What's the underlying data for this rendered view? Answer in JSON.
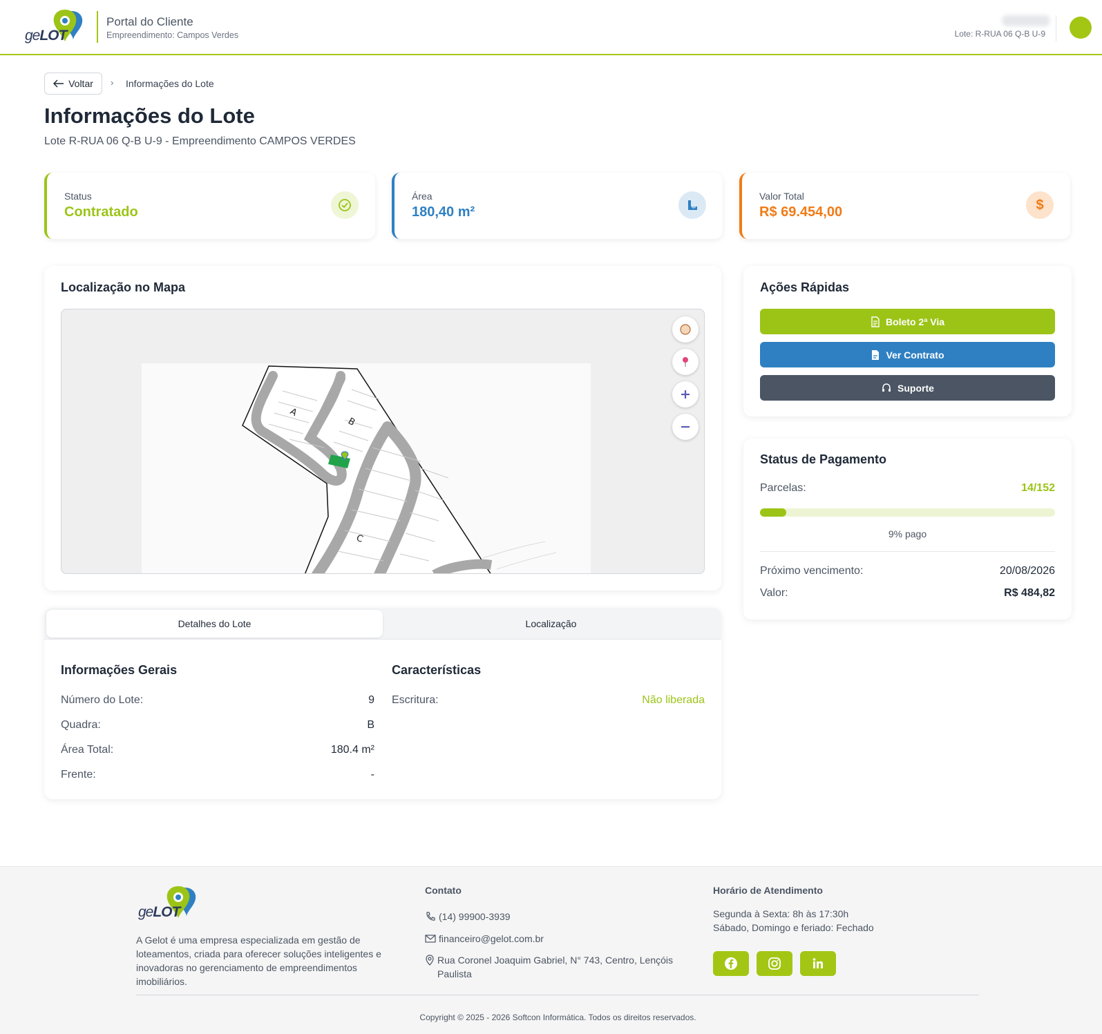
{
  "header": {
    "logo_ge": "ge",
    "logo_lot": "LOT",
    "portal_title": "Portal do Cliente",
    "portal_subtitle": "Empreendimento: Campos Verdes",
    "user_lote": "Lote: R-RUA 06 Q-B U-9"
  },
  "breadcrumb": {
    "back_label": "Voltar",
    "separator": "›",
    "current": "Informações do Lote"
  },
  "page": {
    "title": "Informações do Lote",
    "subtitle": "Lote R-RUA 06 Q-B U-9 - Empreendimento CAMPOS VERDES"
  },
  "stats": [
    {
      "label": "Status",
      "value": "Contratado",
      "color": "#9cc417",
      "icon": "check-circle-icon"
    },
    {
      "label": "Área",
      "value": "180,40 m²",
      "color": "#2f80c2",
      "icon": "ruler-icon"
    },
    {
      "label": "Valor Total",
      "value": "R$ 69.454,00",
      "color": "#f07b16",
      "icon": "dollar-icon"
    }
  ],
  "map": {
    "title": "Localização no Mapa",
    "blocks": [
      "A",
      "B",
      "C"
    ]
  },
  "quick_actions": {
    "title": "Ações Rápidas",
    "buttons": [
      {
        "label": "Boleto 2ª Via",
        "color": "#9cc417",
        "icon": "document-icon"
      },
      {
        "label": "Ver Contrato",
        "color": "#2f80c2",
        "icon": "file-icon"
      },
      {
        "label": "Suporte",
        "color": "#4b5563",
        "icon": "headset-icon"
      }
    ]
  },
  "payment": {
    "title": "Status de Pagamento",
    "parcelas_label": "Parcelas:",
    "parcelas_value": "14/152",
    "progress_fraction": 0.09,
    "paid_label": "9% pago",
    "next_due_label": "Próximo vencimento:",
    "next_due_value": "20/08/2026",
    "amount_label": "Valor:",
    "amount_value": "R$ 484,82"
  },
  "tabs": [
    {
      "label": "Detalhes do Lote",
      "active": true
    },
    {
      "label": "Localização",
      "active": false
    }
  ],
  "details": {
    "general_title": "Informações Gerais",
    "general": [
      {
        "label": "Número do Lote:",
        "value": "9"
      },
      {
        "label": "Quadra:",
        "value": "B"
      },
      {
        "label": "Área Total:",
        "value": "180.4 m²"
      },
      {
        "label": "Frente:",
        "value": "-"
      }
    ],
    "features_title": "Características",
    "features": [
      {
        "label": "Escritura:",
        "value": "Não liberada"
      }
    ]
  },
  "footer": {
    "about": "A Gelot é uma empresa especializada em gestão de loteamentos, criada para oferecer soluções inteligentes e inovadoras no gerenciamento de empreendimentos imobiliários.",
    "contact_title": "Contato",
    "phone": "(14) 99900-3939",
    "email": "financeiro@gelot.com.br",
    "address": "Rua Coronel Joaquim Gabriel, N° 743, Centro, Lençóis Paulista",
    "hours_title": "Horário de Atendimento",
    "hours_week": "Segunda à Sexta: 8h às 17:30h",
    "hours_weekend": "Sábado, Domingo e feriado: Fechado",
    "copyright": "Copyright © 2025 - 2026 Softcon Informática. Todos os direitos reservados."
  }
}
